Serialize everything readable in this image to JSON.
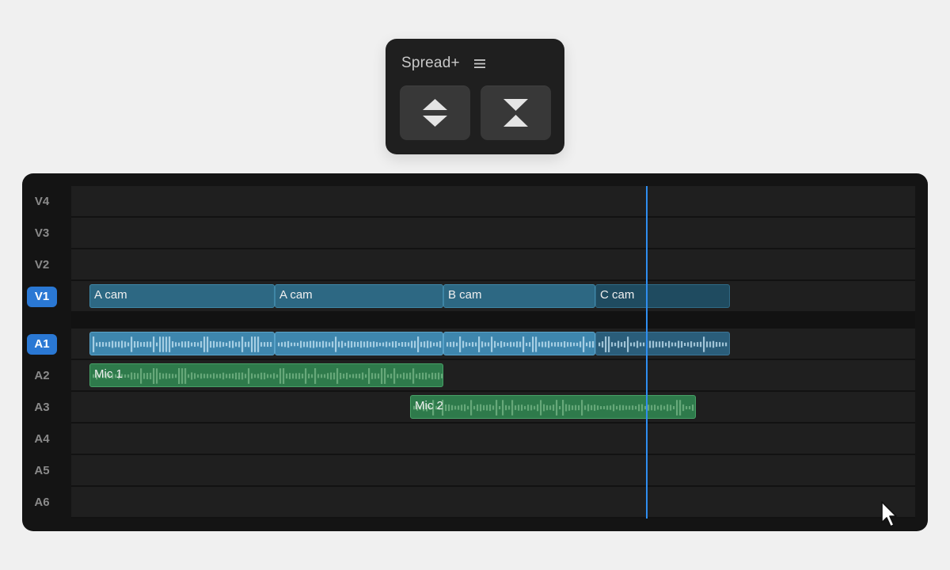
{
  "panel": {
    "title": "Spread+",
    "menu_icon": "hamburger-menu-icon",
    "buttons": [
      {
        "name": "expand-tracks-button",
        "icon": "expand-vertical-icon"
      },
      {
        "name": "collapse-tracks-button",
        "icon": "collapse-vertical-icon"
      }
    ]
  },
  "tracks": {
    "video": [
      "V4",
      "V3",
      "V2",
      "V1"
    ],
    "audio": [
      "A1",
      "A2",
      "A3",
      "A4",
      "A5",
      "A6"
    ],
    "active": [
      "V1",
      "A1"
    ]
  },
  "clips": {
    "v1": [
      {
        "name": "A cam"
      },
      {
        "name": "A cam"
      },
      {
        "name": "B cam"
      },
      {
        "name": "C cam"
      }
    ],
    "a2": {
      "name": "Mic 1"
    },
    "a3": {
      "name": "Mic 2"
    }
  },
  "colors": {
    "accent": "#2a78d4",
    "playhead": "#2f8ef0",
    "video_clip": "#2d6883",
    "audio_clip": "#3e86ad",
    "mic_clip": "#2e7a4b"
  }
}
